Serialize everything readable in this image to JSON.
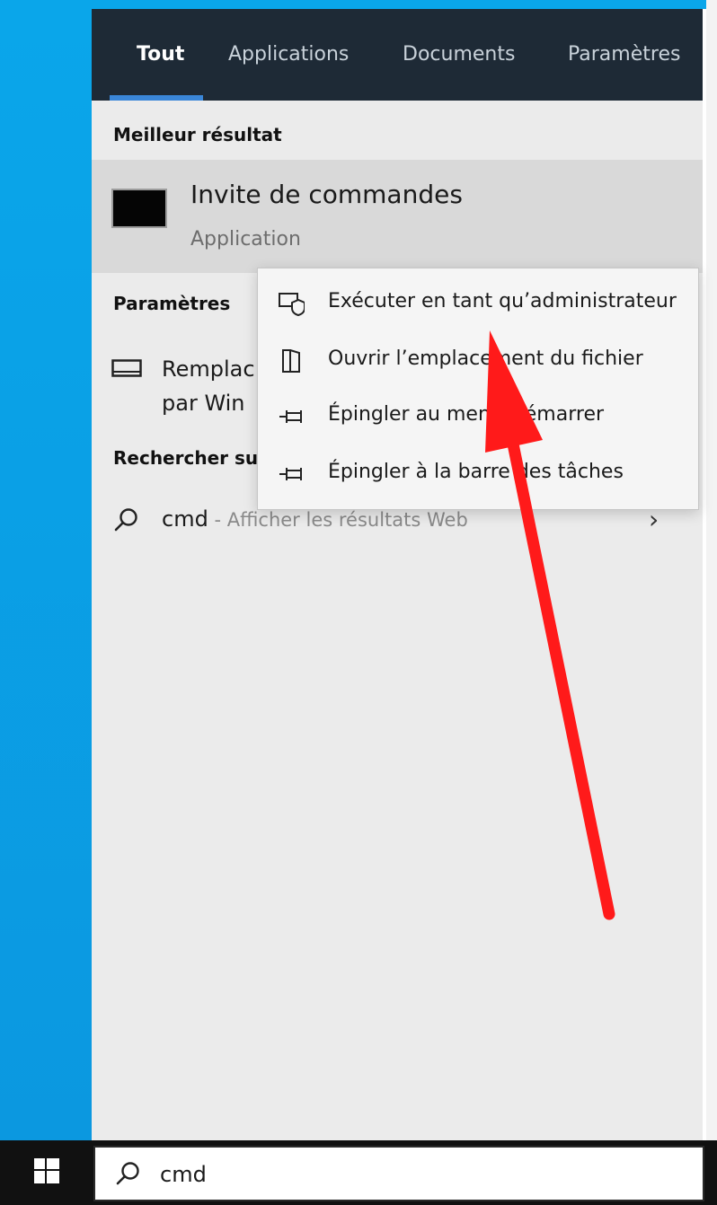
{
  "tabs": [
    {
      "label": "Tout",
      "active": true
    },
    {
      "label": "Applications",
      "active": false
    },
    {
      "label": "Documents",
      "active": false
    },
    {
      "label": "Paramètres",
      "active": false
    }
  ],
  "sections": {
    "best_match": "Meilleur résultat",
    "settings": "Paramètres",
    "web": "Rechercher su"
  },
  "best_result": {
    "name": "Invite de commandes",
    "type": "Application",
    "icon": "command-prompt-icon"
  },
  "setting_item": {
    "line1": "Remplac",
    "line2": "par Win",
    "icon": "monitor-icon"
  },
  "web_item": {
    "query": "cmd",
    "suffix": " - Afficher les résultats Web",
    "icon": "search-icon"
  },
  "context_menu": [
    {
      "label": "Exécuter en tant qu’administrateur",
      "icon": "run-as-admin-icon"
    },
    {
      "label": "Ouvrir l’emplacement du fichier",
      "icon": "open-file-location-icon"
    },
    {
      "label": "Épingler au menu Démarrer",
      "icon": "pin-icon"
    },
    {
      "label": "Épingler à la barre des tâches",
      "icon": "pin-icon"
    }
  ],
  "search_box": {
    "value": "cmd",
    "icon": "search-icon"
  },
  "colors": {
    "tab_bar": "#1e2a36",
    "accent": "#3a86d8",
    "arrow": "#ff1a1a",
    "desktop": "#0aa6ea"
  }
}
